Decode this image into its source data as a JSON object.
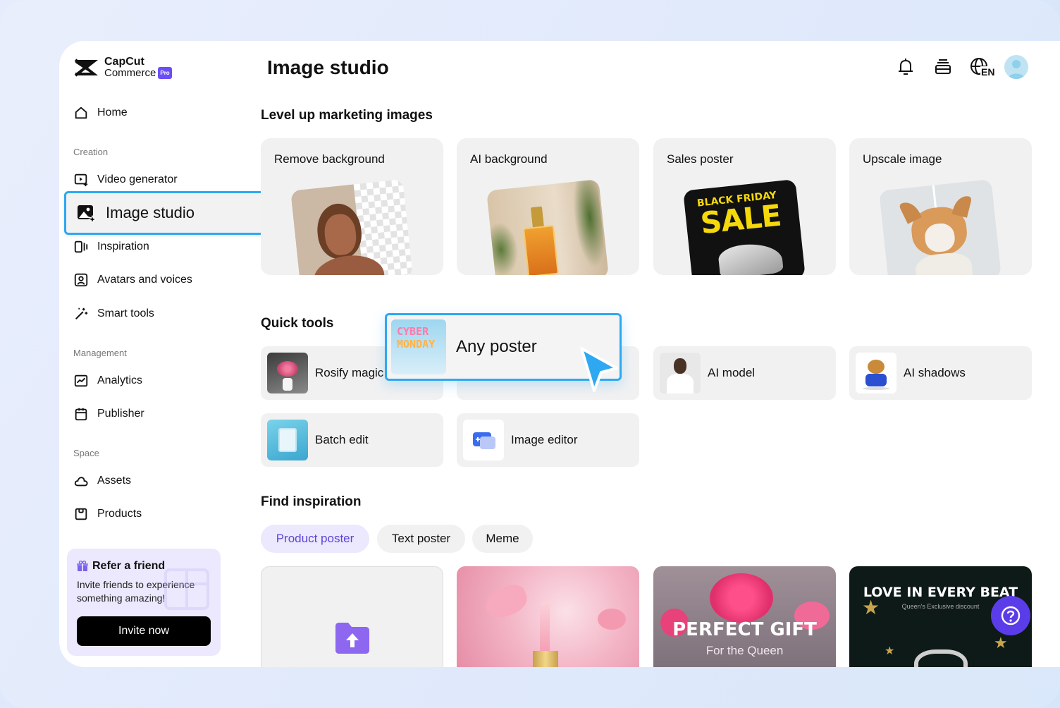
{
  "brand": {
    "line1": "CapCut",
    "line2": "Commerce",
    "badge": "Pro"
  },
  "page": {
    "title": "Image studio"
  },
  "header": {
    "language": "EN"
  },
  "sidebar": {
    "home": "Home",
    "creation_label": "Creation",
    "creation": [
      "Video generator",
      "Image studio",
      "Inspiration",
      "Avatars and voices",
      "Smart tools"
    ],
    "management_label": "Management",
    "management": [
      "Analytics",
      "Publisher"
    ],
    "space_label": "Space",
    "space": [
      "Assets",
      "Products"
    ]
  },
  "refer": {
    "title": "Refer a friend",
    "desc": "Invite friends to experience something amazing!",
    "button": "Invite now"
  },
  "sections": {
    "level_up": "Level up marketing images",
    "quick_tools": "Quick tools",
    "find_inspiration": "Find inspiration"
  },
  "big_cards": [
    "Remove background",
    "AI background",
    "Sales poster",
    "Upscale image"
  ],
  "sales_art": {
    "line1": "BLACK FRIDAY",
    "line2": "SALE"
  },
  "quick_tools": {
    "rosify": "Rosify magic",
    "ai_model": "AI model",
    "ai_shadows": "AI shadows",
    "batch_edit": "Batch edit",
    "image_editor": "Image editor",
    "any_poster": "Any poster",
    "any_poster_art": [
      "CYBER",
      "MONDAY"
    ]
  },
  "inspiration_tabs": [
    "Product poster",
    "Text poster",
    "Meme"
  ],
  "inspiration_cards": {
    "perfect_gift": {
      "title": "PERFECT GIFT",
      "sub": "For the Queen"
    },
    "love_beat": {
      "title": "LOVE IN EVERY BEAT",
      "sub": "Queen's Exclusive discount"
    }
  },
  "colors": {
    "accent": "#2ea8f0",
    "brand_purple": "#5a3de8",
    "active_pill_bg": "#ece8fd"
  }
}
